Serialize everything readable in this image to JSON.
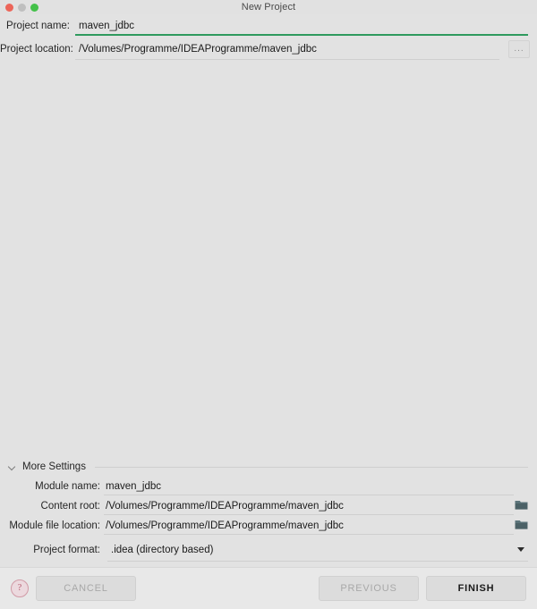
{
  "window": {
    "title": "New Project",
    "traffic_lights": [
      {
        "name": "close",
        "color": "#ec6559"
      },
      {
        "name": "minimize",
        "color": "#bfbfbf"
      },
      {
        "name": "maximize",
        "color": "#44c14a"
      }
    ]
  },
  "form": {
    "project_name": {
      "label": "Project name:",
      "value": "maven_jdbc",
      "underline_color": "#2f9a5e"
    },
    "project_location": {
      "label": "Project location:",
      "value": "/Volumes/Programme/IDEAProgramme/maven_jdbc",
      "browse_label": "..."
    }
  },
  "more_settings": {
    "title": "More Settings",
    "expanded": true,
    "chevron_icon": "chevron-down-icon",
    "module_name": {
      "label": "Module name:",
      "value": "maven_jdbc"
    },
    "content_root": {
      "label": "Content root:",
      "value": "/Volumes/Programme/IDEAProgramme/maven_jdbc",
      "browse_icon": "folder-icon"
    },
    "module_file_location": {
      "label": "Module file location:",
      "value": "/Volumes/Programme/IDEAProgramme/maven_jdbc",
      "browse_icon": "folder-icon"
    },
    "project_format": {
      "label": "Project format:",
      "value": ".idea (directory based)",
      "caret_icon": "chevron-down-icon"
    }
  },
  "buttons": {
    "help": {
      "label": "?",
      "icon": "help-icon"
    },
    "cancel": {
      "label": "CANCEL",
      "enabled": false
    },
    "previous": {
      "label": "PREVIOUS",
      "enabled": false
    },
    "finish": {
      "label": "FINISH",
      "enabled": true
    }
  }
}
